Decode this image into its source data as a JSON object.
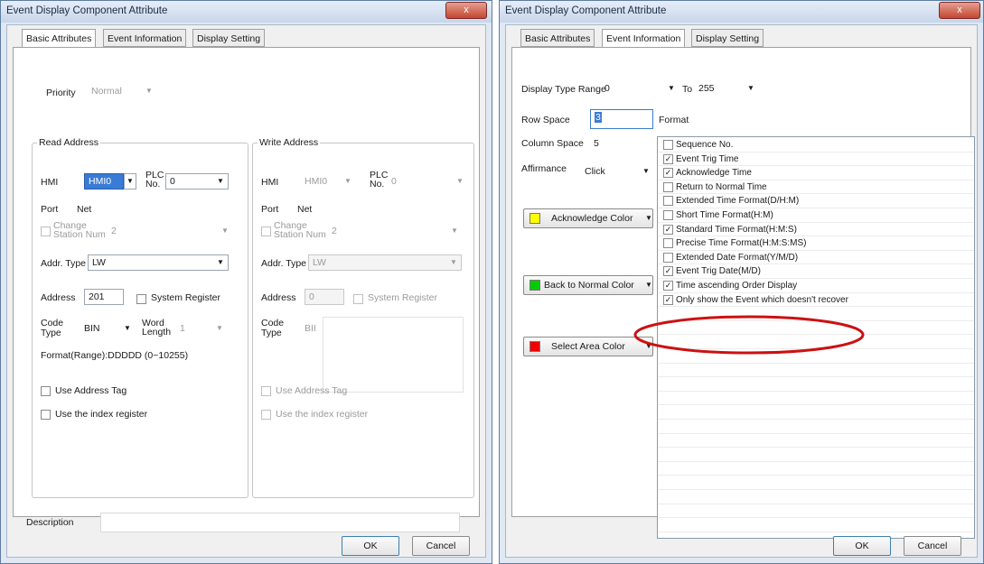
{
  "left": {
    "title": "Event Display Component Attribute",
    "close": "x",
    "tabs": [
      "Basic Attributes",
      "Event Information",
      "Display Setting"
    ],
    "priority_label": "Priority",
    "priority_value": "Normal",
    "read": {
      "title": "Read Address",
      "hmi_label": "HMI",
      "hmi_value": "HMI0",
      "plc_label": "PLC\nNo.",
      "plc_value": "0",
      "port_label": "Port",
      "port_value": "Net",
      "change_station_label": "Change\nStation Num",
      "change_station_value": "2",
      "addr_type_label": "Addr. Type",
      "addr_type_value": "LW",
      "address_label": "Address",
      "address_value": "201",
      "system_register_label": "System Register",
      "code_type_label": "Code\nType",
      "code_type_value": "BIN",
      "word_length_label": "Word\nLength",
      "word_length_value": "1",
      "format_text": "Format(Range):DDDDD (0~10255)",
      "use_address_tag": "Use Address Tag",
      "use_index_register": "Use the index register"
    },
    "write": {
      "title": "Write Address",
      "hmi_label": "HMI",
      "hmi_value": "HMI0",
      "plc_label": "PLC\nNo.",
      "plc_value": "0",
      "port_label": "Port",
      "port_value": "Net",
      "change_station_label": "Change\nStation Num",
      "change_station_value": "2",
      "addr_type_label": "Addr. Type",
      "addr_type_value": "LW",
      "address_label": "Address",
      "address_value": "0",
      "system_register_label": "System Register",
      "code_type_label": "Code\nType",
      "code_type_value": "BII",
      "use_address_tag": "Use Address Tag",
      "use_index_register": "Use the index register"
    },
    "description_label": "Description",
    "ok": "OK",
    "cancel": "Cancel"
  },
  "right": {
    "title": "Event Display Component Attribute",
    "close": "x",
    "tabs": [
      "Basic Attributes",
      "Event Information",
      "Display Setting"
    ],
    "display_type_range_label": "Display Type Range",
    "range_from": "0",
    "to_label": "To",
    "range_to": "255",
    "row_space_label": "Row Space",
    "row_space_value": "3",
    "format_label": "Format",
    "column_space_label": "Column Space",
    "column_space_value": "5",
    "affirmance_label": "Affirmance",
    "affirmance_value": "Click",
    "acknowledge_color": "Acknowledge Color",
    "back_to_normal_color": "Back to Normal Color",
    "select_area_color": "Select Area Color",
    "format_items": [
      {
        "label": "Sequence No.",
        "checked": false
      },
      {
        "label": "Event Trig Time",
        "checked": true
      },
      {
        "label": "Acknowledge Time",
        "checked": true
      },
      {
        "label": "Return to Normal Time",
        "checked": false
      },
      {
        "label": "Extended Time Format(D/H:M)",
        "checked": false
      },
      {
        "label": "Short Time Format(H:M)",
        "checked": false
      },
      {
        "label": "Standard Time Format(H:M:S)",
        "checked": true
      },
      {
        "label": "Precise Time Format(H:M:S:MS)",
        "checked": false
      },
      {
        "label": "Extended Date Format(Y/M/D)",
        "checked": false
      },
      {
        "label": "Event Trig Date(M/D)",
        "checked": true
      },
      {
        "label": "Time ascending Order Display",
        "checked": true
      },
      {
        "label": "Only show the Event which doesn't recover",
        "checked": true
      }
    ],
    "ok": "OK",
    "cancel": "Cancel"
  },
  "colors": {
    "acknowledge": "#ffff00",
    "back_to_normal": "#00cc00",
    "select_area": "#ee0000",
    "annotation_ellipse": "#cc1111",
    "selected_field": "#3a7bd5"
  }
}
